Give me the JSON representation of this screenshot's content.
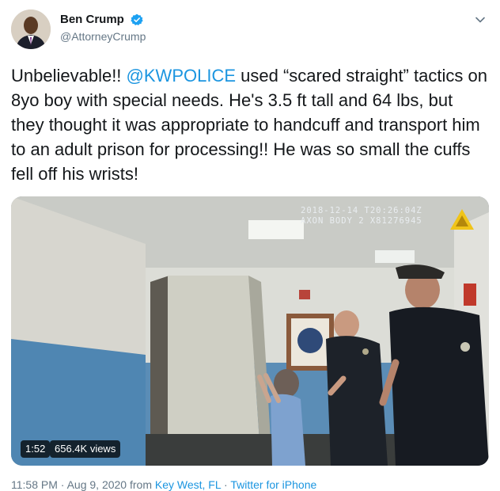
{
  "author": {
    "display_name": "Ben Crump",
    "handle": "@AttorneyCrump"
  },
  "tweet": {
    "text_parts": {
      "lead": "Unbelievable!! ",
      "mention": "@KWPOLICE",
      "rest": " used “scared straight” tactics on 8yo boy with special needs. He's 3.5 ft tall and 64 lbs, but they thought it was appropriate to handcuff and transport him to an adult prison for processing!! He was so small the cuffs fell off his wrists!"
    }
  },
  "video": {
    "overlay_timestamp": "2018-12-14 T20:26:04Z",
    "overlay_device": "AXON BODY 2 X81276945",
    "duration": "1:52",
    "views": "656.4K views"
  },
  "meta": {
    "time": "11:58 PM",
    "date": "Aug 9, 2020",
    "from_label": "from",
    "location": "Key West, FL",
    "source": "Twitter for iPhone",
    "separator": "·"
  },
  "colors": {
    "link": "#1b95e0",
    "secondary_text": "#657786",
    "verified": "#1da1f2",
    "wall_blue": "#4f86b2"
  }
}
